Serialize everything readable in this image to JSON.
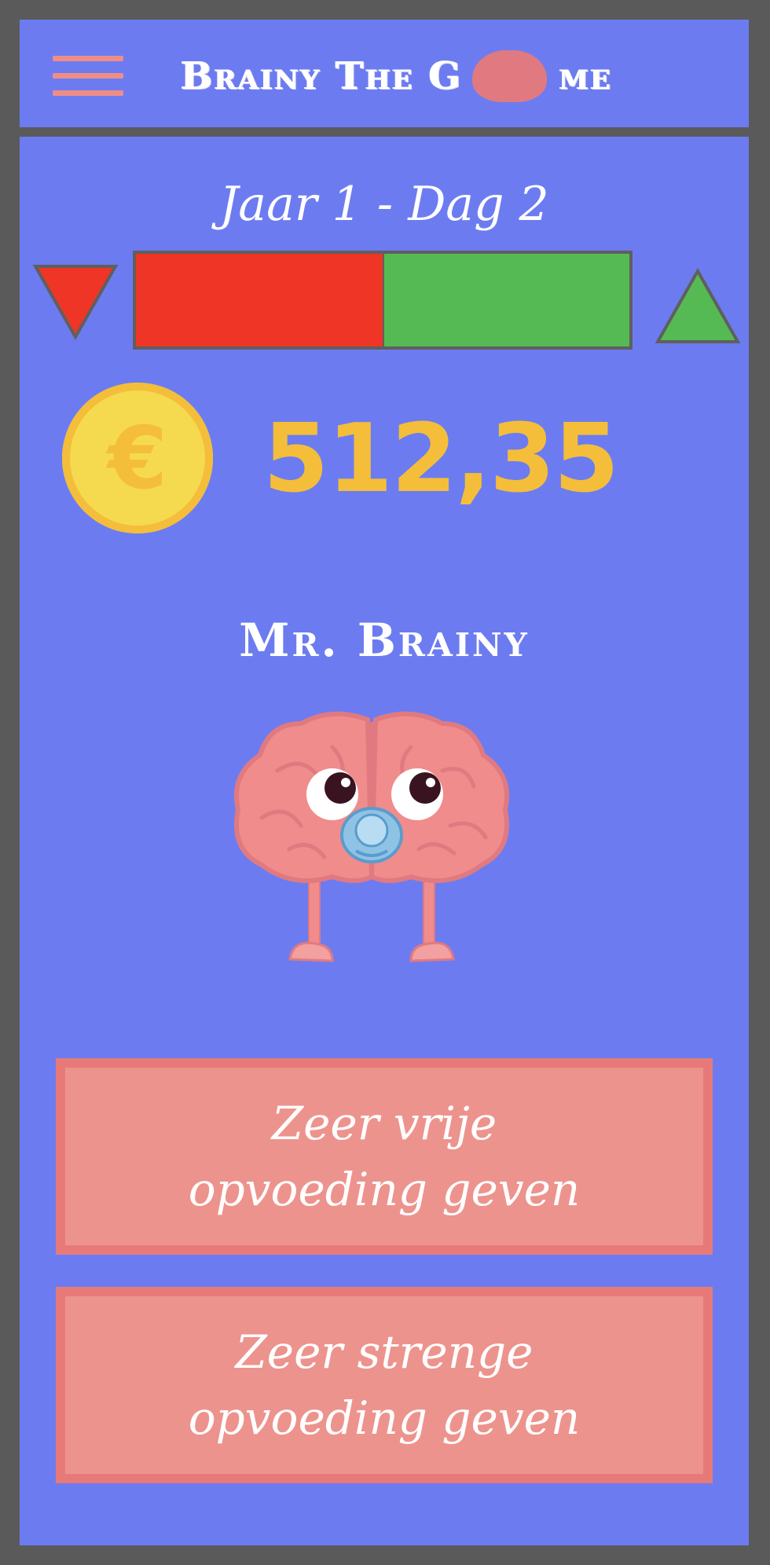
{
  "header": {
    "title_part1": "Brainy The G",
    "title_part2": "me"
  },
  "game": {
    "day_label": "Jaar 1 - Dag 2",
    "balance_fraction": 0.5,
    "currency_symbol": "€",
    "money": "512,35",
    "character_name": "Mr. Brainy"
  },
  "choices": [
    {
      "line1": "Zeer vrije",
      "line2": "opvoeding geven"
    },
    {
      "line1": "Zeer strenge",
      "line2": "opvoeding geven"
    }
  ],
  "colors": {
    "background": "#6c7cf0",
    "frame": "#5a5a5a",
    "bar_negative": "#ee3526",
    "bar_positive": "#55ba53",
    "coin": "#f5da50",
    "money": "#f4be3a",
    "button_fill": "#ed938d",
    "button_border": "#e77a78",
    "brain": "#f08c8c"
  },
  "icons": {
    "menu": "hamburger-icon",
    "decrease": "triangle-down-icon",
    "increase": "triangle-up-icon",
    "coin": "euro-coin-icon",
    "character": "baby-brain-character"
  }
}
